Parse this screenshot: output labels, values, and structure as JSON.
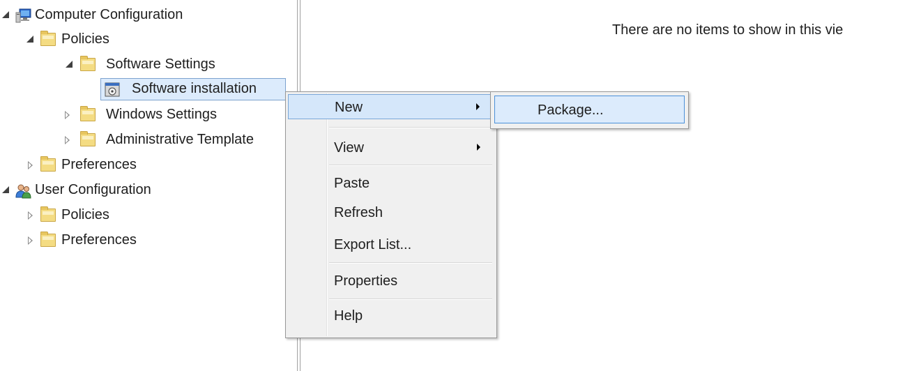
{
  "tree": {
    "computer_configuration": "Computer Configuration",
    "policies": "Policies",
    "software_settings": "Software Settings",
    "software_installation": "Software installation",
    "windows_settings": "Windows Settings",
    "administrative_templates": "Administrative Template",
    "preferences": "Preferences",
    "user_configuration": "User Configuration",
    "user_policies": "Policies",
    "user_preferences": "Preferences"
  },
  "content": {
    "empty_message": "There are no items to show in this vie"
  },
  "context_menu": {
    "items": [
      "New",
      "View",
      "Paste",
      "Refresh",
      "Export List...",
      "Properties",
      "Help"
    ]
  },
  "submenu": {
    "items": [
      "Package..."
    ]
  },
  "icons": {
    "computer": "computer-icon",
    "folder": "folder-icon",
    "software_installation": "software-installation-icon",
    "users": "users-icon",
    "submenu_arrow": "submenu-arrow-icon"
  },
  "colors": {
    "selection_bg": "#dcebfc",
    "selection_border": "#7da2ce",
    "menu_bg": "#f0f0f0",
    "folder": "#f4dc83"
  }
}
